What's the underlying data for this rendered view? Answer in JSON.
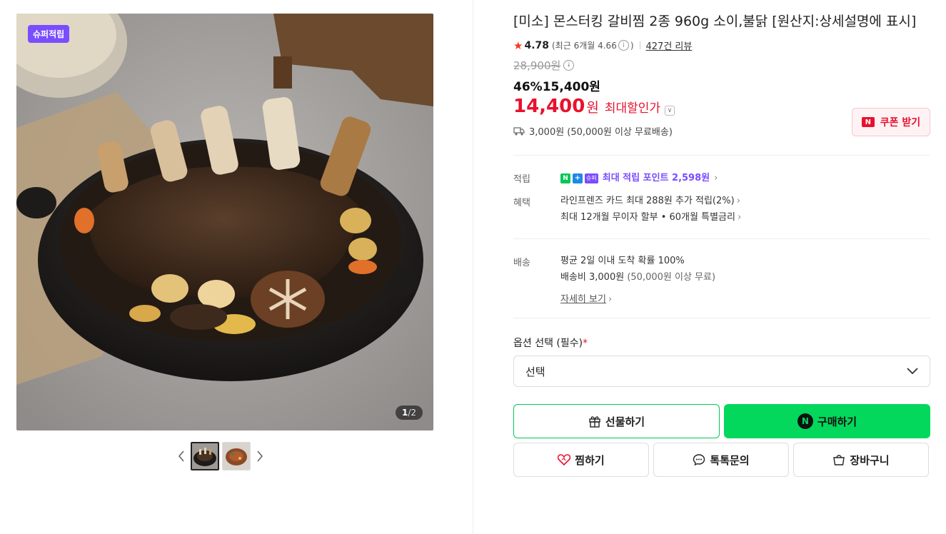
{
  "gallery": {
    "badge": "슈퍼적립",
    "counter_current": "1",
    "counter_total": "/2",
    "prev_arrow": "‹",
    "next_arrow": "›"
  },
  "product": {
    "title": "[미소] 몬스터킹 갈비찜 2종 960g 소이,불닭 [원산지:상세설명에 표시]",
    "rating": "4.78",
    "recent_rating": "(최근 6개월 4.66",
    "recent_close": ")",
    "reviews": "427건 리뷰",
    "original_price": "28,900원",
    "discount_rate": "46%",
    "sale_price": "15,400원",
    "max_price": "14,400",
    "max_unit": "원",
    "max_label": "최대할인가",
    "coupon_label": "쿠폰 받기",
    "coupon_n": "N",
    "shipping": "3,000원 (50,000원 이상 무료배송)"
  },
  "benefits": {
    "point_key": "적립",
    "point_badge_n": "N",
    "point_badge_plus": "+",
    "point_badge_super": "슈퍼",
    "point_text": "최대 적립 포인트 2,598원",
    "benefit_key": "혜택",
    "benefit_1": "라인프렌즈 카드 최대 288원 추가 적립(2%)",
    "benefit_2": "최대 12개월 무이자 할부 • 60개월 특별금리"
  },
  "delivery": {
    "key": "배송",
    "line_1": "평균 2일 이내 도착 확률 100%",
    "line_2": "배송비 3,000원",
    "line_2_muted": "(50,000원 이상 무료)",
    "more": "자세히 보기"
  },
  "options": {
    "label": "옵션 선택 (필수)",
    "required_mark": "*",
    "select_value": "선택"
  },
  "actions": {
    "gift": "선물하기",
    "buy": "구매하기",
    "buy_n": "N",
    "wish": "찜하기",
    "talk": "톡톡문의",
    "cart": "장바구니"
  },
  "colors": {
    "accent_green": "#03d85c",
    "price_red": "#e8112d",
    "super_purple": "#7a4dff"
  }
}
